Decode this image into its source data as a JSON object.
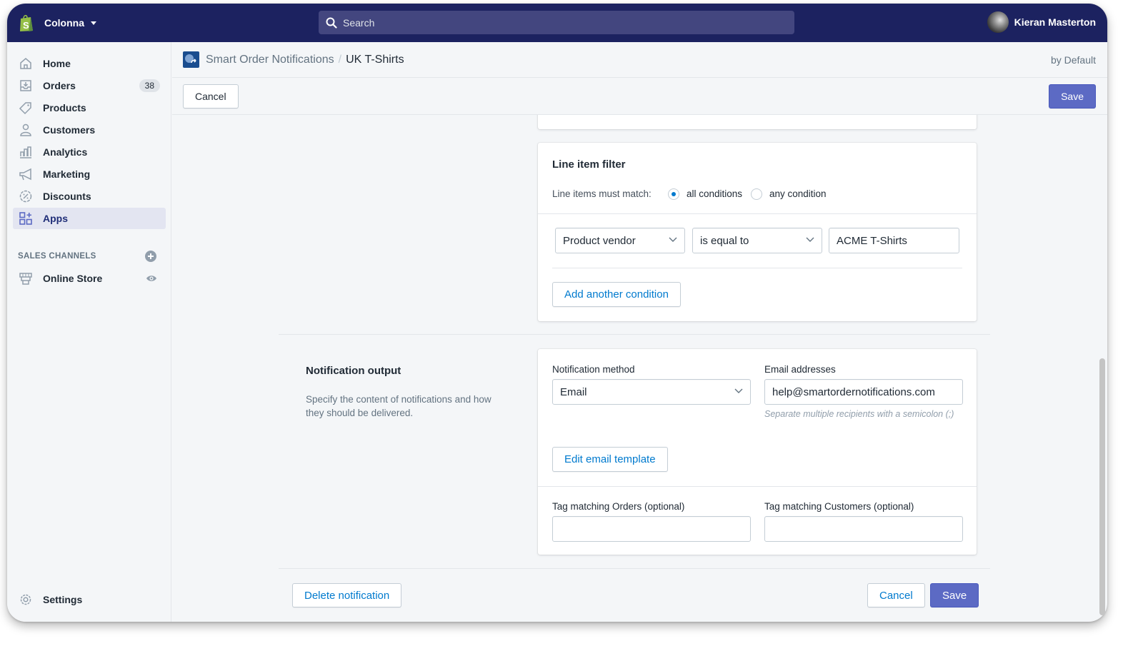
{
  "topbar": {
    "store_name": "Colonna",
    "search_placeholder": "Search",
    "user_name": "Kieran Masterton"
  },
  "sidebar": {
    "items": [
      {
        "label": "Home",
        "icon": "home-icon"
      },
      {
        "label": "Orders",
        "icon": "orders-icon",
        "badge": "38"
      },
      {
        "label": "Products",
        "icon": "tag-icon"
      },
      {
        "label": "Customers",
        "icon": "person-icon"
      },
      {
        "label": "Analytics",
        "icon": "bar-chart-icon"
      },
      {
        "label": "Marketing",
        "icon": "megaphone-icon"
      },
      {
        "label": "Discounts",
        "icon": "discount-icon"
      },
      {
        "label": "Apps",
        "icon": "apps-icon",
        "active": true
      }
    ],
    "sales_channels_heading": "SALES CHANNELS",
    "channels": [
      {
        "label": "Online Store",
        "icon": "store-icon"
      }
    ],
    "settings_label": "Settings"
  },
  "header": {
    "breadcrumb_app": "Smart Order Notifications",
    "breadcrumb_separator": "/",
    "breadcrumb_current": "UK T-Shirts",
    "by_default": "by Default"
  },
  "actionbar": {
    "cancel_label": "Cancel",
    "save_label": "Save"
  },
  "line_item_filter": {
    "title": "Line item filter",
    "match_label": "Line items must match:",
    "options": [
      {
        "label": "all conditions",
        "selected": true
      },
      {
        "label": "any condition",
        "selected": false
      }
    ],
    "condition": {
      "field": "Product vendor",
      "operator": "is equal to",
      "value": "ACME T-Shirts"
    },
    "add_condition_label": "Add another condition"
  },
  "notification_output": {
    "title": "Notification output",
    "description": "Specify the content of notifications and how they should be delivered.",
    "method_label": "Notification method",
    "method_value": "Email",
    "emails_label": "Email addresses",
    "emails_value": "help@smartordernotifications.com",
    "emails_help": "Separate multiple recipients with a semicolon (;)",
    "edit_template_label": "Edit email template",
    "tag_orders_label": "Tag matching Orders (optional)",
    "tag_orders_value": "",
    "tag_customers_label": "Tag matching Customers (optional)",
    "tag_customers_value": ""
  },
  "footer": {
    "delete_label": "Delete notification",
    "cancel_label": "Cancel",
    "save_label": "Save"
  },
  "colors": {
    "topbar": "#1c2260",
    "primary": "#5c6ac4",
    "link": "#007ace",
    "logo_green": "#95bf47"
  }
}
